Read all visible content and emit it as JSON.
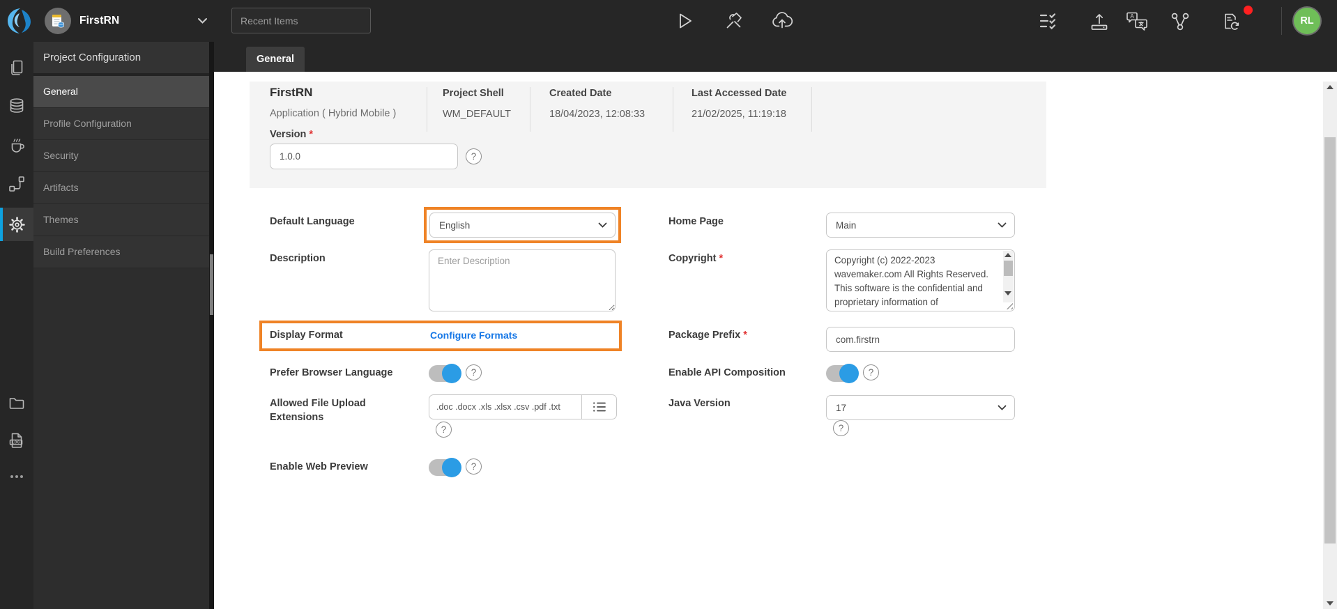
{
  "colors": {
    "accent_orange": "#ef8326",
    "link_blue": "#1677e6",
    "toggle_on_blue": "#2b9ce5",
    "rail_active_blue": "#0ea2e0",
    "avatar_green": "#6fbe58",
    "notification_red": "#ff2020",
    "required_red": "#e03131"
  },
  "header": {
    "logo_icon": "wavemaker-logo",
    "project_icon": "project-avatar-icon",
    "project_name": "FirstRN",
    "project_switcher_icon": "chevron-down-icon",
    "search": {
      "placeholder": "Recent Items"
    },
    "center_icons": [
      "run-icon",
      "tools-icon",
      "deploy-icon"
    ],
    "right_icons": [
      "checklist-icon",
      "export-icon",
      "translate-icon",
      "version-control-icon",
      "sync-doc-icon"
    ],
    "has_notification": true,
    "avatar_initials": "RL"
  },
  "rail": {
    "items": [
      {
        "icon": "pages-icon",
        "active": false
      },
      {
        "icon": "database-icon",
        "active": false
      },
      {
        "icon": "java-services-icon",
        "active": false
      },
      {
        "icon": "apis-icon",
        "active": false
      },
      {
        "icon": "settings-icon",
        "active": true
      },
      {
        "icon": "files-icon",
        "active": false
      },
      {
        "icon": "logs-icon",
        "active": false
      },
      {
        "icon": "more-icon",
        "active": false
      }
    ]
  },
  "sidebar": {
    "title": "Project Configuration",
    "items": [
      {
        "label": "General",
        "active": true
      },
      {
        "label": "Profile Configuration",
        "active": false
      },
      {
        "label": "Security",
        "active": false
      },
      {
        "label": "Artifacts",
        "active": false
      },
      {
        "label": "Themes",
        "active": false
      },
      {
        "label": "Build Preferences",
        "active": false
      }
    ]
  },
  "main": {
    "tab": "General",
    "summary": {
      "name": "FirstRN",
      "type": "Application ( Hybrid Mobile )",
      "fields": [
        {
          "label": "Project Shell",
          "value": "WM_DEFAULT"
        },
        {
          "label": "Created Date",
          "value": "18/04/2023, 12:08:33"
        },
        {
          "label": "Last Accessed Date",
          "value": "21/02/2025, 11:19:18"
        }
      ],
      "version": {
        "label": "Version",
        "value": "1.0.0",
        "required": true
      }
    },
    "form": {
      "default_language": {
        "label": "Default Language",
        "value": "English",
        "highlighted": true
      },
      "home_page": {
        "label": "Home Page",
        "value": "Main"
      },
      "description": {
        "label": "Description",
        "placeholder": "Enter Description"
      },
      "copyright": {
        "label": "Copyright",
        "required": true,
        "value": "Copyright (c) 2022-2023 wavemaker.com All Rights Reserved.  This software is the confidential and proprietary information of"
      },
      "display_format": {
        "label": "Display Format",
        "link": "Configure Formats",
        "highlighted": true
      },
      "package_prefix": {
        "label": "Package Prefix",
        "required": true,
        "value": "com.firstrn"
      },
      "prefer_browser_language": {
        "label": "Prefer Browser Language",
        "enabled": true
      },
      "enable_api_composition": {
        "label": "Enable API Composition",
        "enabled": true
      },
      "allowed_file_upload_extensions": {
        "label": "Allowed File Upload Extensions",
        "value": ".doc .docx .xls .xlsx .csv .pdf .txt"
      },
      "java_version": {
        "label": "Java Version",
        "value": "17"
      },
      "enable_web_preview": {
        "label": "Enable Web Preview",
        "enabled": true
      }
    }
  }
}
